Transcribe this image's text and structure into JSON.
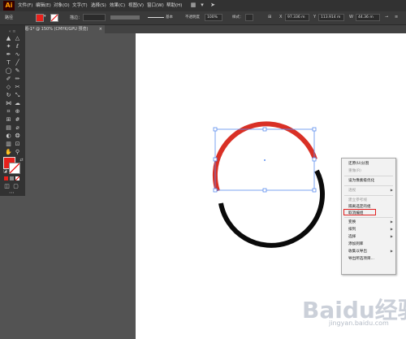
{
  "app": {
    "logo": "Ai"
  },
  "menubar": {
    "items": [
      "文件(F)",
      "编辑(E)",
      "对象(O)",
      "文字(T)",
      "选择(S)",
      "效果(C)",
      "视图(V)",
      "窗口(W)",
      "帮助(H)"
    ],
    "icons": [
      "layout-icon",
      "dropdown-icon",
      "send-icon"
    ]
  },
  "controlbar": {
    "object_type": "路径",
    "stroke_label": "描边：",
    "stroke_style": "基本",
    "opacity_label": "不透明度",
    "opacity_value": "100%",
    "style_label": "样式：",
    "x_value": "97.336 m",
    "y_value": "113.914 m",
    "w_value": "44.36 m"
  },
  "document": {
    "tab_title": "未标题-1* @ 150% (CMYK/GPU 预览)"
  },
  "colors": {
    "fill": "#e8211c",
    "arc_red": "#d93025",
    "arc_black": "#0a0a0a",
    "selection": "#5b8def"
  },
  "context_menu": {
    "items": [
      {
        "label": "还原(U)分割",
        "disabled": false
      },
      {
        "label": "重做(R)",
        "disabled": true
      },
      {
        "label": "设为像素级优化",
        "disabled": false
      },
      {
        "label": "透视",
        "disabled": true,
        "submenu": true
      },
      {
        "label": "建立参考线",
        "disabled": true
      },
      {
        "label": "隔离选定的组",
        "disabled": false
      },
      {
        "label": "取消编组",
        "disabled": false,
        "highlighted": true
      },
      {
        "label": "变换",
        "disabled": false,
        "submenu": true
      },
      {
        "label": "排列",
        "disabled": false,
        "submenu": true
      },
      {
        "label": "选择",
        "disabled": false,
        "submenu": true
      },
      {
        "label": "添加到库",
        "disabled": false
      },
      {
        "label": "收集以导出",
        "disabled": false,
        "submenu": true
      },
      {
        "label": "导出所选项目...",
        "disabled": false
      }
    ]
  },
  "watermark": {
    "text": "Baidu经验",
    "sub": "jingyan.baidu.com"
  }
}
